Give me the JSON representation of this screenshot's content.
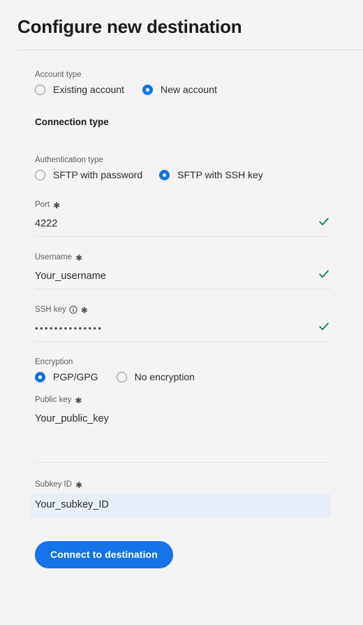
{
  "header": {
    "title": "Configure new destination"
  },
  "form": {
    "account_type": {
      "label": "Account type",
      "options": [
        {
          "label": "Existing account",
          "selected": false
        },
        {
          "label": "New account",
          "selected": true
        }
      ]
    },
    "connection_type_heading": "Connection type",
    "authentication_type": {
      "label": "Authentication type",
      "options": [
        {
          "label": "SFTP with password",
          "selected": false
        },
        {
          "label": "SFTP with SSH key",
          "selected": true
        }
      ]
    },
    "port": {
      "label": "Port",
      "required_marker": "✱",
      "value": "4222",
      "valid": true
    },
    "username": {
      "label": "Username",
      "required_marker": "✱",
      "value": "Your_username",
      "valid": true
    },
    "ssh_key": {
      "label": "SSH key",
      "required_marker": "✱",
      "info_icon": "info-circle-icon",
      "value": "••••••••••••••",
      "valid": true
    },
    "encryption": {
      "label": "Encryption",
      "options": [
        {
          "label": "PGP/GPG",
          "selected": true
        },
        {
          "label": "No encryption",
          "selected": false
        }
      ]
    },
    "public_key": {
      "label": "Public key",
      "required_marker": "✱",
      "value": "Your_public_key"
    },
    "subkey_id": {
      "label": "Subkey ID",
      "required_marker": "✱",
      "value": "Your_subkey_ID",
      "highlighted": true
    },
    "submit_button": {
      "label": "Connect to destination"
    }
  },
  "colors": {
    "accent_blue": "#1473e6",
    "valid_green": "#16845a",
    "page_background": "#f4f4f4",
    "highlight_background": "#e8effa",
    "divider": "#e2e2e2"
  },
  "icons": {
    "valid_check": "check-icon",
    "info": "info-circle-icon"
  }
}
